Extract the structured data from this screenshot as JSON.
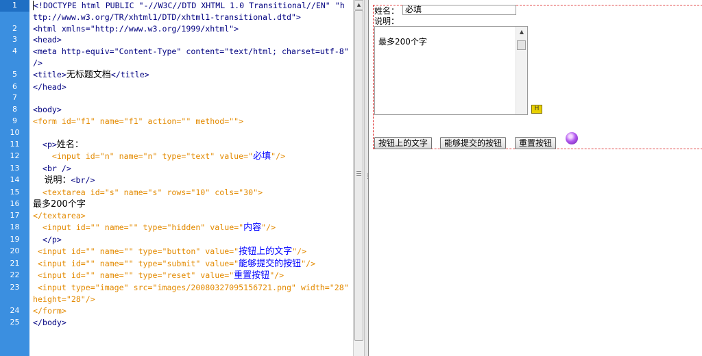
{
  "editor": {
    "lines": [
      {
        "n": "1",
        "current": true,
        "segs": [
          {
            "c": "tag",
            "t": "<!DOCTYPE html PUBLIC \"-//W3C//DTD XHTML 1.0 Transitional//EN\" \"http://www.w3.org/TR/xhtml1/DTD/xhtml1-transitional.dtd\">"
          }
        ]
      },
      {
        "n": "2",
        "segs": [
          {
            "c": "tag",
            "t": "<html xmlns=\"http://www.w3.org/1999/xhtml\">"
          }
        ]
      },
      {
        "n": "3",
        "segs": [
          {
            "c": "tag",
            "t": "<head>"
          }
        ]
      },
      {
        "n": "4",
        "segs": [
          {
            "c": "tag",
            "t": "<meta http-equiv=\"Content-Type\" content=\"text/html; charset=utf-8\" />"
          }
        ]
      },
      {
        "n": "5",
        "segs": [
          {
            "c": "tag",
            "t": "<title>"
          },
          {
            "c": "txt cjk",
            "t": "无标题文档"
          },
          {
            "c": "tag",
            "t": "</title>"
          }
        ]
      },
      {
        "n": "6",
        "segs": [
          {
            "c": "tag",
            "t": "</head>"
          }
        ]
      },
      {
        "n": "7",
        "segs": []
      },
      {
        "n": "8",
        "segs": [
          {
            "c": "tag",
            "t": "<body>"
          }
        ]
      },
      {
        "n": "9",
        "segs": [
          {
            "c": "tag orange",
            "t": "<form id=\"f1\" name=\"f1\" action=\"\" method=\"\">"
          }
        ]
      },
      {
        "n": "10",
        "segs": []
      },
      {
        "n": "11",
        "segs": [
          {
            "c": "tag",
            "t": "  <p>"
          },
          {
            "c": "txt cjk",
            "t": "姓名："
          }
        ]
      },
      {
        "n": "12",
        "segs": [
          {
            "c": "tag orange",
            "t": "    <input id=\"n\" name=\"n\" type=\"text\" value=\""
          },
          {
            "c": "val cjk",
            "t": "必填"
          },
          {
            "c": "tag orange",
            "t": "\"/>"
          }
        ]
      },
      {
        "n": "13",
        "segs": [
          {
            "c": "tag",
            "t": "  <br />"
          }
        ]
      },
      {
        "n": "14",
        "segs": [
          {
            "c": "txt cjk",
            "t": "    说明："
          },
          {
            "c": "tag",
            "t": "<br/>"
          }
        ]
      },
      {
        "n": "15",
        "segs": [
          {
            "c": "tag orange",
            "t": "  <textarea id=\"s\" name=\"s\" rows=\"10\" cols=\"30\">"
          }
        ]
      },
      {
        "n": "16",
        "segs": [
          {
            "c": "txt cjk",
            "t": "最多200个字"
          }
        ]
      },
      {
        "n": "17",
        "segs": [
          {
            "c": "tag orange",
            "t": "</textarea>"
          }
        ]
      },
      {
        "n": "18",
        "segs": [
          {
            "c": "tag orange",
            "t": "  <input id=\"\" name=\"\" type=\"hidden\" value=\""
          },
          {
            "c": "val cjk",
            "t": "内容"
          },
          {
            "c": "tag orange",
            "t": "\"/>"
          }
        ]
      },
      {
        "n": "19",
        "segs": [
          {
            "c": "tag",
            "t": "  </p>"
          }
        ]
      },
      {
        "n": "20",
        "segs": [
          {
            "c": "tag orange",
            "t": " <input id=\"\" name=\"\" type=\"button\" value=\""
          },
          {
            "c": "val cjk",
            "t": "按钮上的文字"
          },
          {
            "c": "tag orange",
            "t": "\"/>"
          }
        ]
      },
      {
        "n": "21",
        "segs": [
          {
            "c": "tag orange",
            "t": " <input id=\"\" name=\"\" type=\"submit\" value=\""
          },
          {
            "c": "val cjk",
            "t": "能够提交的按钮"
          },
          {
            "c": "tag orange",
            "t": "\"/>"
          }
        ]
      },
      {
        "n": "22",
        "segs": [
          {
            "c": "tag orange",
            "t": " <input id=\"\" name=\"\" type=\"reset\" value=\""
          },
          {
            "c": "val cjk",
            "t": "重置按钮"
          },
          {
            "c": "tag orange",
            "t": "\"/>"
          }
        ]
      },
      {
        "n": "23",
        "segs": [
          {
            "c": "tag orange",
            "t": " <input type=\"image\" src=\"images/20080327095156721.png\" width=\"28\" height=\"28\"/>"
          }
        ]
      },
      {
        "n": "24",
        "segs": [
          {
            "c": "tag orange",
            "t": "</form>"
          }
        ]
      },
      {
        "n": "25",
        "segs": [
          {
            "c": "tag",
            "t": "</body>"
          }
        ]
      }
    ]
  },
  "design": {
    "name_label": "姓名：",
    "name_value": "必填",
    "desc_label": "说明：",
    "textarea_text": "最多200个字",
    "button_text": "按钮上的文字",
    "submit_text": "能够提交的按钮",
    "reset_text": "重置按钮"
  },
  "icons": {
    "hidden_field": "hidden-field-icon",
    "image_input": "purple-orb-icon"
  },
  "colors": {
    "gutter": "#3b8fe0",
    "tag": "#000080",
    "attr_orange": "#e38a00",
    "value_blue": "#0000ff",
    "form_outline": "#e04040"
  }
}
